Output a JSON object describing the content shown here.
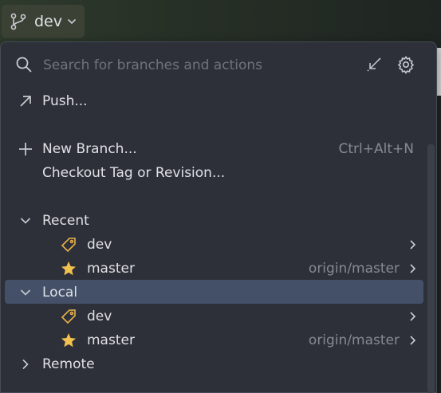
{
  "branch_widget": {
    "branch_name": "dev"
  },
  "search": {
    "placeholder": "Search for branches and actions"
  },
  "actions": {
    "push_label": "Push...",
    "new_branch_label": "New Branch...",
    "new_branch_shortcut": "Ctrl+Alt+N",
    "checkout_label": "Checkout Tag or Revision..."
  },
  "groups": {
    "recent": {
      "label": "Recent",
      "branches": [
        {
          "name": "dev",
          "remote": ""
        },
        {
          "name": "master",
          "remote": "origin/master"
        }
      ]
    },
    "local": {
      "label": "Local",
      "branches": [
        {
          "name": "dev",
          "remote": ""
        },
        {
          "name": "master",
          "remote": "origin/master"
        }
      ]
    },
    "remote": {
      "label": "Remote"
    }
  },
  "colors": {
    "selection": "#435068",
    "tag_icon": "#e8b24a",
    "star_icon": "#f2c14e",
    "text": "#dfe1e5",
    "muted": "#868a91"
  }
}
